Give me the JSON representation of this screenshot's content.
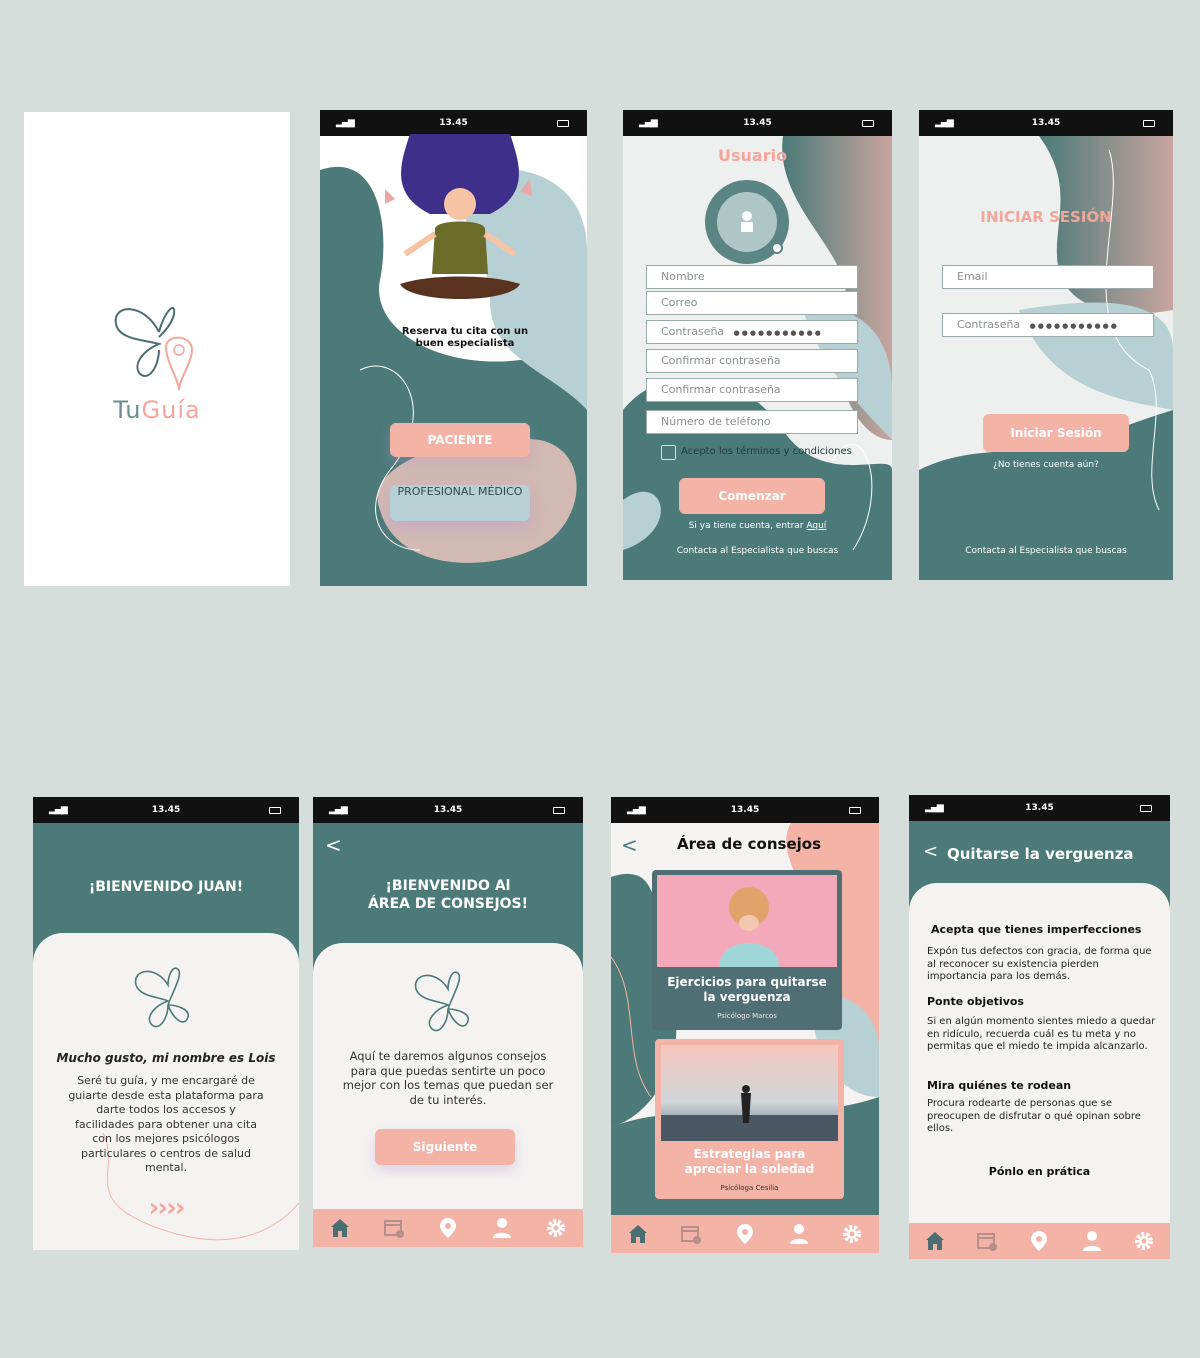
{
  "status": {
    "time": "13.45"
  },
  "splash": {
    "logo_text_tu": "Tu",
    "logo_text_guia": "Guía"
  },
  "screen2": {
    "tagline": "Reserva tu cita con un buen especialista",
    "btn_patient": "PACIENTE",
    "btn_professional": "PROFESIONAL MÉDICO"
  },
  "register": {
    "title": "Usuario",
    "fields": {
      "name": "Nombre",
      "email": "Correo",
      "password": "Contraseña",
      "password_dots": "●●●●●●●●●●●",
      "confirm1": "Confirmar contraseña",
      "confirm2": "Confirmar contraseña",
      "phone": "Número de teléfono"
    },
    "terms": "Acepto los términos y condiciones",
    "btn_start": "Comenzar",
    "login_prompt": "Si ya tiene cuenta, entrar",
    "login_link": "Aquí",
    "footer": "Contacta al Especialista que buscas"
  },
  "login": {
    "title": "INICIAR SESIÓN",
    "email": "Email",
    "password": "Contraseña",
    "password_dots": "●●●●●●●●●●●",
    "btn_login": "Iniciar Sesión",
    "no_account": "¿No tienes cuenta aún?",
    "footer": "Contacta al Especialista que buscas"
  },
  "welcome": {
    "title": "¡BIENVENIDO JUAN!",
    "greeting": "Mucho gusto, mi nombre es Lois",
    "body": "Seré tu guía, y me encargaré de guiarte desde esta plataforma  para darte todos los accesos y facilidades para obtener una cita  con los mejores psicólogos particulares o centros de salud mental.",
    "arrows": "››››"
  },
  "advice_intro": {
    "title_line1": "¡BIENVENIDO Al",
    "title_line2": "ÁREA DE CONSEJOS!",
    "body": "Aquí te daremos algunos consejos para que puedas sentirte un poco mejor con los temas que puedan ser de tu interés.",
    "btn_next": "Siguiente"
  },
  "advice_area": {
    "title": "Área de consejos",
    "card1_title": "Ejercicios para quitarse la verguenza",
    "card1_author": "Psicólogo Marcos",
    "card2_title": "Estrategias para apreciar la soledad",
    "card2_author": "Psicóloga Cesilia"
  },
  "article": {
    "title": "Quitarse  la verguenza",
    "h1": "Acepta que tienes imperfecciones",
    "p1": "Expón tus defectos con gracia, de forma que al reconocer su existencia pierden importancia para los demás.",
    "h2": "Ponte objetivos",
    "p2": "Si en algún momento sientes miedo a quedar en ridículo, recuerda cuál es tu meta y no permitas que el miedo te impida alcanzarlo.",
    "h3": "Mira quiénes te rodean",
    "p3": "Procura rodearte de personas que se preocupen de disfrutar o qué opinan sobre ellos.",
    "cta": "Pónlo en prática"
  },
  "colors": {
    "teal": "#4b7a78",
    "pink": "#f4b3a7",
    "lightblue": "#b7d0d3",
    "bg": "#d5dedb"
  },
  "icons": [
    "home-icon",
    "calendar-icon",
    "location-icon",
    "user-icon",
    "gear-icon"
  ]
}
